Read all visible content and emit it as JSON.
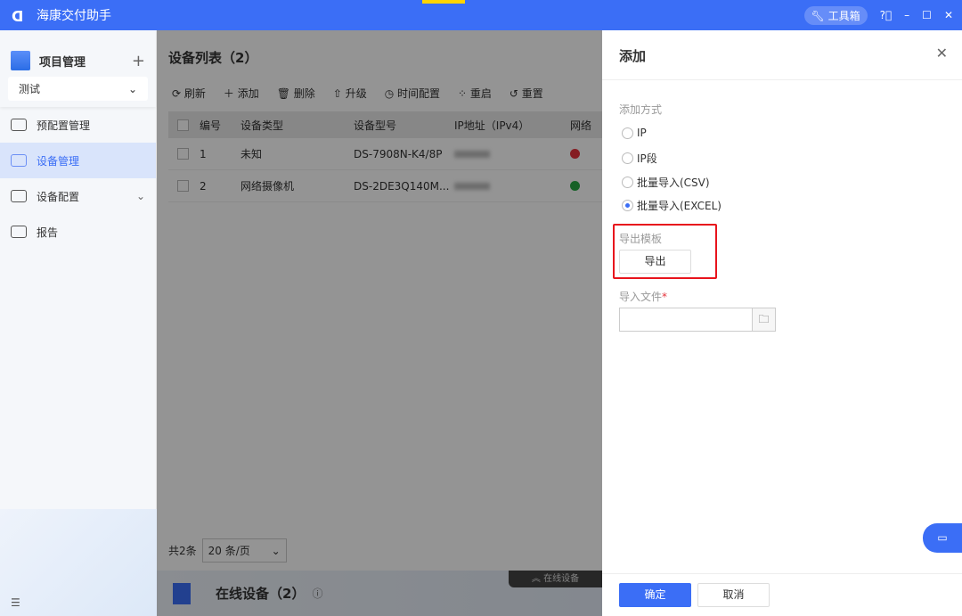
{
  "app": {
    "title": "海康交付助手",
    "toolbox": "工具箱"
  },
  "sidebar": {
    "project_title": "项目管理",
    "project_select": "测试",
    "items": [
      {
        "label": "预配置管理",
        "icon": "gear-icon"
      },
      {
        "label": "设备管理",
        "icon": "device-icon",
        "active": true
      },
      {
        "label": "设备配置",
        "icon": "device-config-icon"
      },
      {
        "label": "报告",
        "icon": "report-icon"
      }
    ]
  },
  "main": {
    "title": "设备列表（2）",
    "toolbar": [
      "刷新",
      "添加",
      "删除",
      "升级",
      "时间配置",
      "重启",
      "重置"
    ],
    "columns": [
      "编号",
      "设备类型",
      "设备型号",
      "IP地址（IPv4）",
      "网络"
    ],
    "rows": [
      {
        "no": "1",
        "type": "未知",
        "model": "DS-7908N-K4/8P",
        "status": "offline"
      },
      {
        "no": "2",
        "type": "网络摄像机",
        "model": "DS-2DE3Q140M...",
        "status": "online"
      }
    ],
    "total": "共2条",
    "page_size": "20 条/页",
    "online_title": "在线设备（2）",
    "online_tab": "在线设备"
  },
  "drawer": {
    "title": "添加",
    "method_label": "添加方式",
    "methods": [
      "IP",
      "IP段",
      "批量导入(CSV)",
      "批量导入(EXCEL)"
    ],
    "selected": "批量导入(EXCEL)",
    "template_label": "导出模板",
    "export_button": "导出",
    "file_label": "导入文件",
    "required_mark": "*",
    "file_value": "",
    "ok": "确定",
    "cancel": "取消"
  },
  "colors": {
    "accent": "#3b6ef6",
    "highlight": "#e8141c",
    "offline": "#e5323b",
    "online": "#27a844"
  }
}
